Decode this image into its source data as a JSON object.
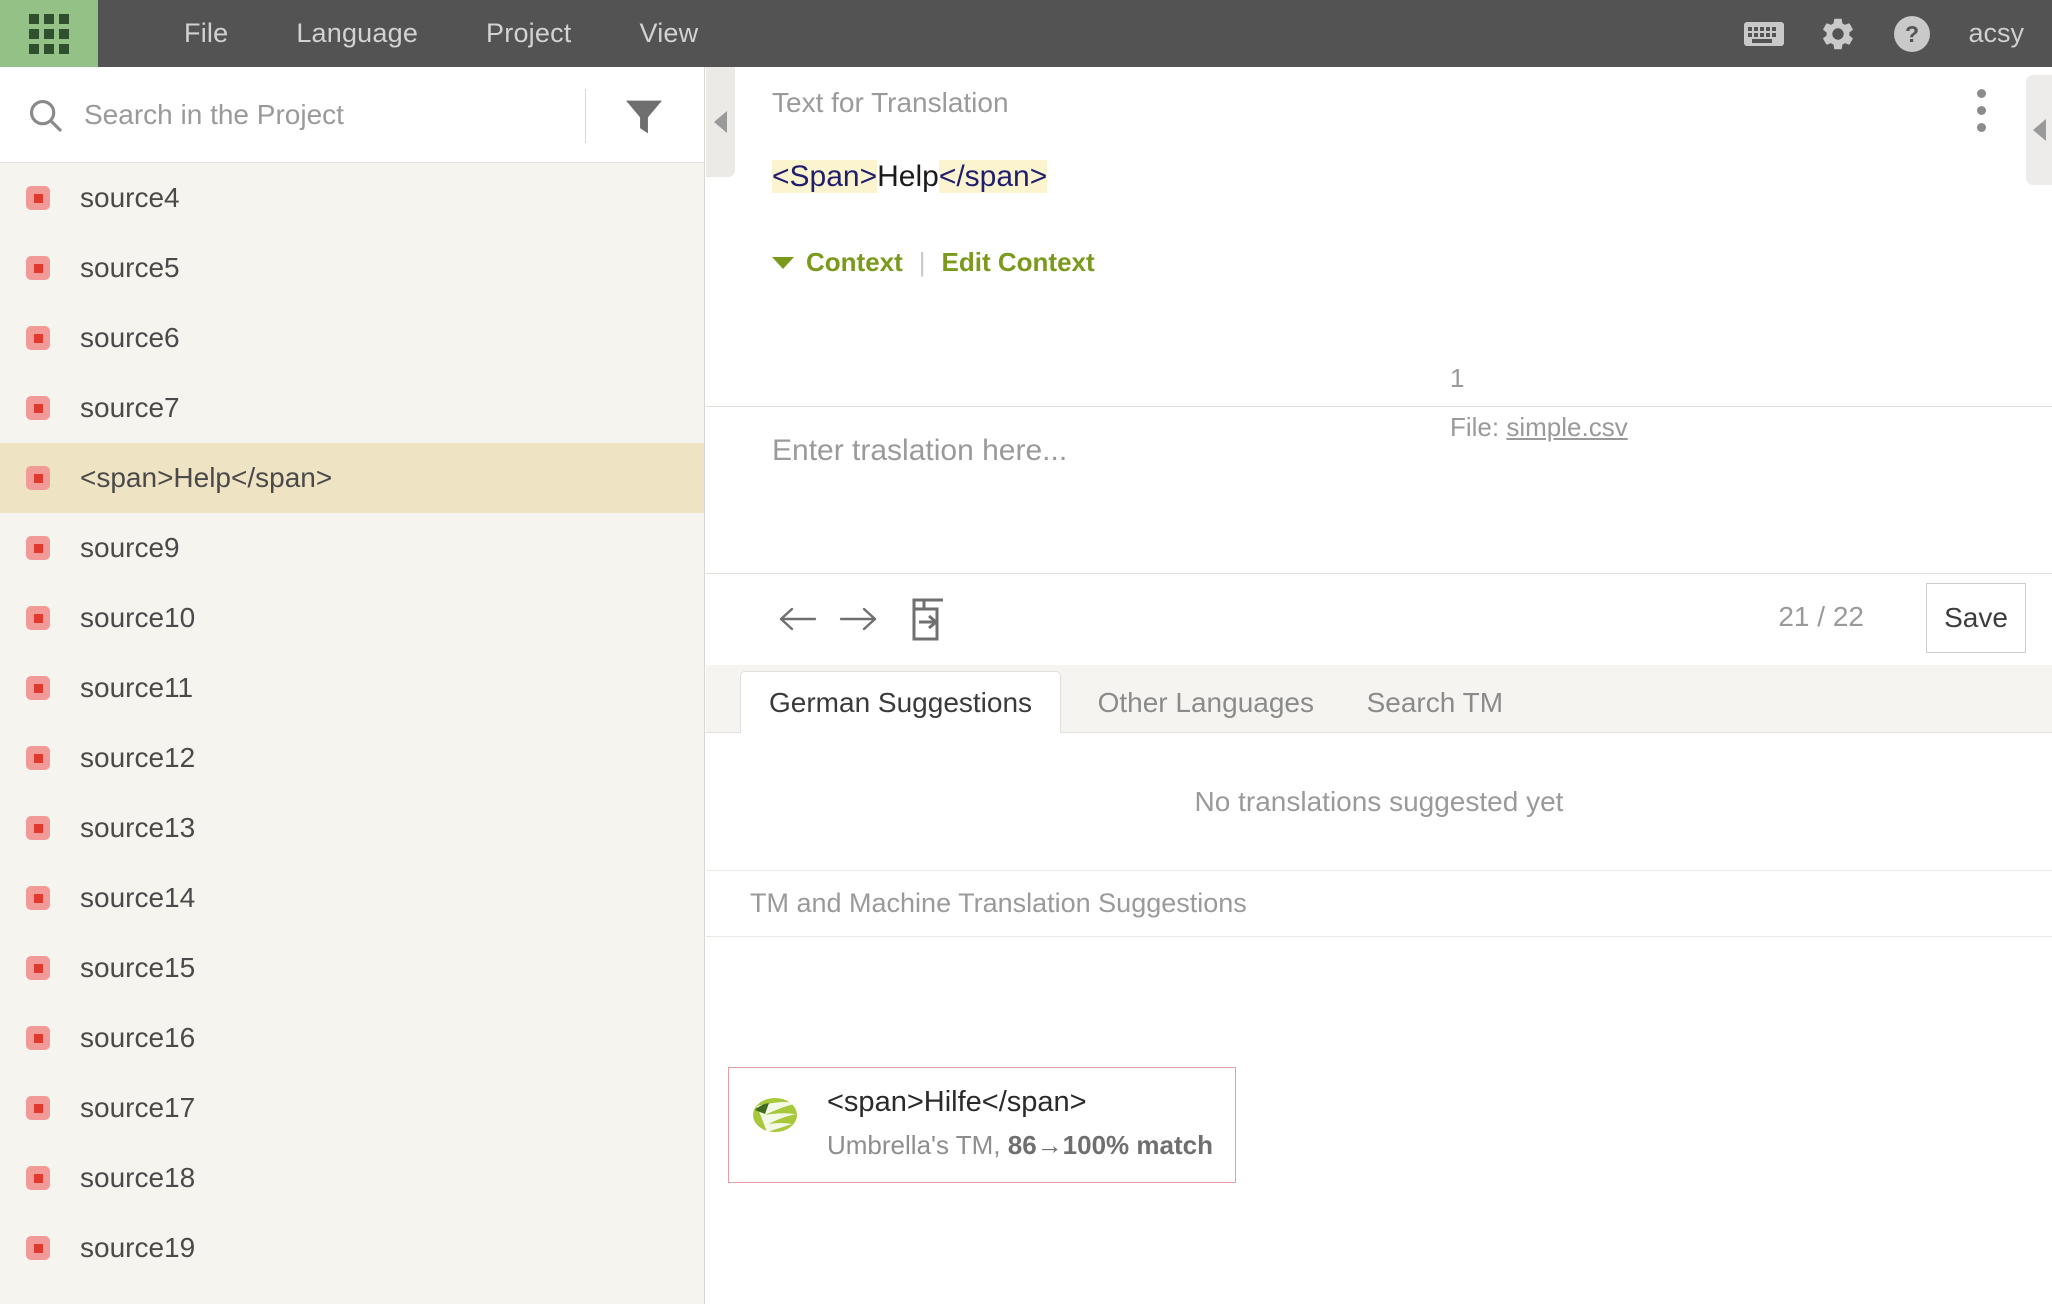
{
  "topbar": {
    "apps_icon": "apps-grid-icon",
    "menu": [
      {
        "label": "File"
      },
      {
        "label": "Language"
      },
      {
        "label": "Project"
      },
      {
        "label": "View"
      }
    ],
    "icons": [
      {
        "name": "keyboard-icon"
      },
      {
        "name": "gear-icon"
      },
      {
        "name": "help-icon"
      }
    ],
    "user": "acsy",
    "bg_color": "#535353",
    "apps_tile_color": "#93c186"
  },
  "sidebar": {
    "search": {
      "placeholder": "Search in the Project",
      "value": "",
      "icon": "search-icon"
    },
    "filter_icon": "filter-funnel-icon",
    "items": [
      {
        "label": "source4",
        "selected": false
      },
      {
        "label": "source5",
        "selected": false
      },
      {
        "label": "source6",
        "selected": false
      },
      {
        "label": "source7",
        "selected": false
      },
      {
        "label": "<span>Help</span>",
        "selected": true
      },
      {
        "label": "source9",
        "selected": false
      },
      {
        "label": "source10",
        "selected": false
      },
      {
        "label": "source11",
        "selected": false
      },
      {
        "label": "source12",
        "selected": false
      },
      {
        "label": "source13",
        "selected": false
      },
      {
        "label": "source14",
        "selected": false
      },
      {
        "label": "source15",
        "selected": false
      },
      {
        "label": "source16",
        "selected": false
      },
      {
        "label": "source17",
        "selected": false
      },
      {
        "label": "source18",
        "selected": false
      },
      {
        "label": "source19",
        "selected": false
      }
    ],
    "status_color": "#f29a98",
    "status_inner_color": "#e03a2f",
    "selected_row_color": "#eee3c2"
  },
  "main": {
    "source_header": {
      "title": "Text for Translation",
      "kebab_icon": "more-vertical-icon",
      "collapse_left_icon": "collapse-left-icon",
      "collapse_right_icon": "collapse-right-icon"
    },
    "source_text": {
      "open_tag": "<Span>",
      "body": "Help",
      "close_tag": "</span>",
      "tag_highlight_color": "#fcf3cf",
      "tag_text_color": "#1f1f6e"
    },
    "context": {
      "toggle_label": "Context",
      "separator": "|",
      "edit_label": "Edit Context",
      "accent_color": "#7a9a1c",
      "number": "1",
      "file_prefix": "File:",
      "file_name": "simple.csv"
    },
    "target": {
      "placeholder": "Enter traslation here...",
      "value": ""
    },
    "actions": {
      "prev_icon": "arrow-left-icon",
      "next_icon": "arrow-right-icon",
      "copy_source_icon": "copy-source-to-target-icon",
      "counter": "21 / 22",
      "save_label": "Save"
    },
    "tabs": [
      {
        "label": "German Suggestions",
        "active": true
      },
      {
        "label": "Other Languages",
        "active": false
      },
      {
        "label": "Search TM",
        "active": false
      }
    ],
    "suggestions_empty": "No translations suggested yet",
    "tm_section_title": "TM and Machine Translation Suggestions",
    "tm_results": [
      {
        "logo_icon": "tm-provider-logo-icon",
        "text": "<span>Hilfe</span>",
        "source_label": "Umbrella's TM,",
        "match_label": "86→100% match",
        "border_color": "#e8a0a4"
      }
    ]
  }
}
